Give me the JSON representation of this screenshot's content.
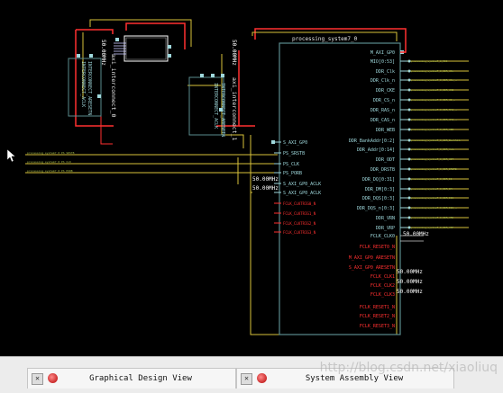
{
  "block": {
    "name": "processing_system7_0",
    "left_ports": [
      "S_AXI_GP0",
      "PS_SRSTB",
      "PS_CLK",
      "PS_PORB",
      "S_AXI_GP0_ACLK",
      "S_AXI_GP0_ACLK"
    ],
    "left_unconnected_ports": [
      "FCLK_CLKTRIG0_N",
      "FCLK_CLKTRIG1_N",
      "FCLK_CLKTRIG2_N",
      "FCLK_CLKTRIG3_N"
    ],
    "right_ports": [
      "M_AXI_GP0",
      "MIO[0:53]",
      "DDR_Clk",
      "DDR_Clk_n",
      "DDR_CKE",
      "DDR_CS_n",
      "DDR_RAS_n",
      "DDR_CAS_n",
      "DDR_WEB",
      "DDR_BankAddr[0:2]",
      "DDR_Addr[0:14]",
      "DDR_ODT",
      "DDR_DRSTB",
      "DDR_DQ[0:31]",
      "DDR_DM[0:3]",
      "DDR_DQS[0:3]",
      "DDR_DQS_n[0:3]",
      "DDR_VRN",
      "DDR_VRP",
      "FCLK_CLK0"
    ],
    "right_red_ports": [
      "FCLK_RESET0_N",
      "M_AXI_GP0_ARESETN",
      "S_AXI_GP0_ARESETN",
      "FCLK_CLK1",
      "FCLK_CLK2",
      "FCLK_CLK3",
      "FCLK_RESET1_N",
      "FCLK_RESET2_N",
      "FCLK_RESET3_N"
    ]
  },
  "interconnects": [
    {
      "name": "axi_interconnect_0",
      "labels": [
        "INTERCONNECT_ACLK",
        "INTERCONNECT_ARESETN"
      ]
    },
    {
      "name": "axi_interconnect_1",
      "labels": [
        "INTERCONNECT_ACLK",
        "INTERCONNECT_ARESETN"
      ]
    }
  ],
  "freq_labels": {
    "vertical_0": "50.00MHz",
    "vertical_1": "50.00MHz",
    "aclk_0": "50.00MHz",
    "aclk_1": "50.00MHz",
    "fclk_clk0": "50.00MHz",
    "fclk_clk1": "50.00MHz",
    "fclk_clk2": "50.00MHz",
    "fclk_clk3": "50.00MHz"
  },
  "external_labels": {
    "left": [
      "processing_system7_0_PS_SRSTB",
      "processing_system7_0_PS_CLK",
      "processing_system7_0_PS_PORB"
    ],
    "right": [
      "processing_system7_0_MIO",
      "processing_system7_0_DDR_Clk",
      "processing_system7_0_DDR_Clk_n",
      "processing_system7_0_DDR_CKE",
      "processing_system7_0_DDR_CS_n",
      "processing_system7_0_DDR_RAS_n",
      "processing_system7_0_DDR_CAS_n",
      "processing_system7_0_DDR_WEB",
      "processing_system7_0_DDR_BankAddr",
      "processing_system7_0_DDR_Addr",
      "processing_system7_0_DDR_ODT",
      "processing_system7_0_DDR_DRSTB",
      "processing_system7_0_DDR_DQ",
      "processing_system7_0_DDR_DM",
      "processing_system7_0_DDR_DQS",
      "processing_system7_0_DDR_DQS_n",
      "processing_system7_0_DDR_VRN",
      "processing_system7_0_DDR_VRP"
    ]
  },
  "tabs": [
    {
      "label": "Graphical Design View"
    },
    {
      "label": "System Assembly View"
    }
  ],
  "watermark": "http://blog.csdn.net/xiaoliuq",
  "colors": {
    "canvas": "#000000",
    "wire": "#d8c23a",
    "red": "#ff3030",
    "cyan": "#9fd8dc",
    "block": "#5a8c8e",
    "white": "#ffffff"
  }
}
